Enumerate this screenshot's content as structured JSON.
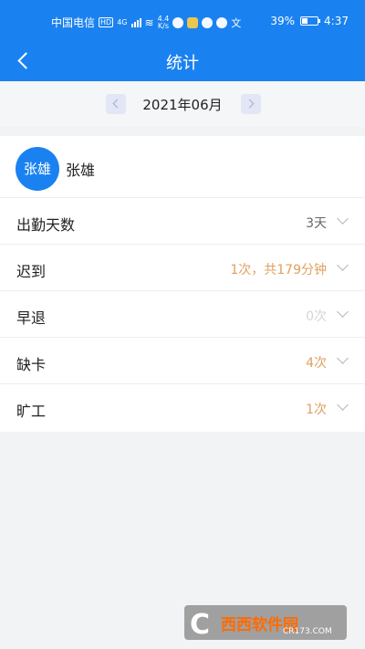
{
  "status_bar": {
    "carrier": "中国电信",
    "hd": "HD",
    "network": "4G",
    "speed_value": "4.4",
    "speed_unit": "K/s",
    "battery": "39%",
    "time": "4:37"
  },
  "nav": {
    "title": "统计"
  },
  "month_selector": {
    "value": "2021年06月"
  },
  "user": {
    "avatar_text": "张雄",
    "name": "张雄"
  },
  "stats": [
    {
      "label": "出勤天数",
      "value": "3天",
      "value_color": "#666666"
    },
    {
      "label": "迟到",
      "value": "1次，共179分钟",
      "value_color": "#e0a060"
    },
    {
      "label": "早退",
      "value": "0次",
      "value_color": "#d6d6d6"
    },
    {
      "label": "缺卡",
      "value": "4次",
      "value_color": "#e0a060"
    },
    {
      "label": "旷工",
      "value": "1次",
      "value_color": "#e0a060"
    }
  ],
  "colors": {
    "primary": "#1a82f0",
    "warning": "#e0a060",
    "muted": "#d6d6d6"
  },
  "watermark": {
    "text": "西西软件园",
    "sub": "CR173.COM"
  }
}
